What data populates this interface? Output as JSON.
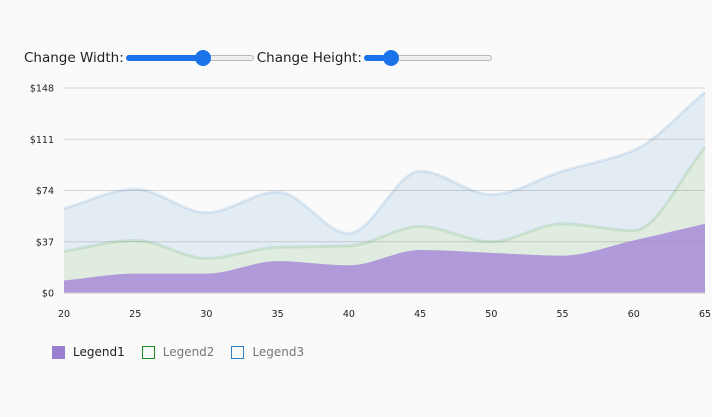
{
  "controls": {
    "width_label": "Change Width:",
    "width_value": 0.62,
    "height_label": "Change Height:",
    "height_value": 0.17
  },
  "colors": {
    "legend1": "#9b7fcf",
    "legend2": "#1e8c1e",
    "legend3": "#2f7fc1"
  },
  "chart_data": {
    "type": "area",
    "x": [
      20,
      25,
      30,
      35,
      40,
      45,
      50,
      55,
      60,
      65
    ],
    "series": [
      {
        "name": "Legend1",
        "values": [
          9,
          14,
          14,
          23,
          20,
          31,
          29,
          27,
          38,
          50
        ]
      },
      {
        "name": "Legend2",
        "values": [
          21,
          24,
          11,
          10,
          14,
          17,
          8,
          23,
          7,
          55
        ]
      },
      {
        "name": "Legend3",
        "values": [
          31,
          37,
          33,
          40,
          9,
          40,
          34,
          38,
          58,
          40
        ]
      }
    ],
    "stacked": true,
    "smooth": true,
    "yticks": [
      "$0",
      "$37",
      "$74",
      "$111",
      "$148"
    ],
    "ytick_values": [
      0,
      37,
      74,
      111,
      148
    ],
    "xticks": [
      "20",
      "25",
      "30",
      "35",
      "40",
      "45",
      "50",
      "55",
      "60",
      "65"
    ],
    "ylim": [
      0,
      148
    ],
    "xlim": [
      20,
      65
    ],
    "grid": true,
    "legend_position": "bottom-left"
  }
}
